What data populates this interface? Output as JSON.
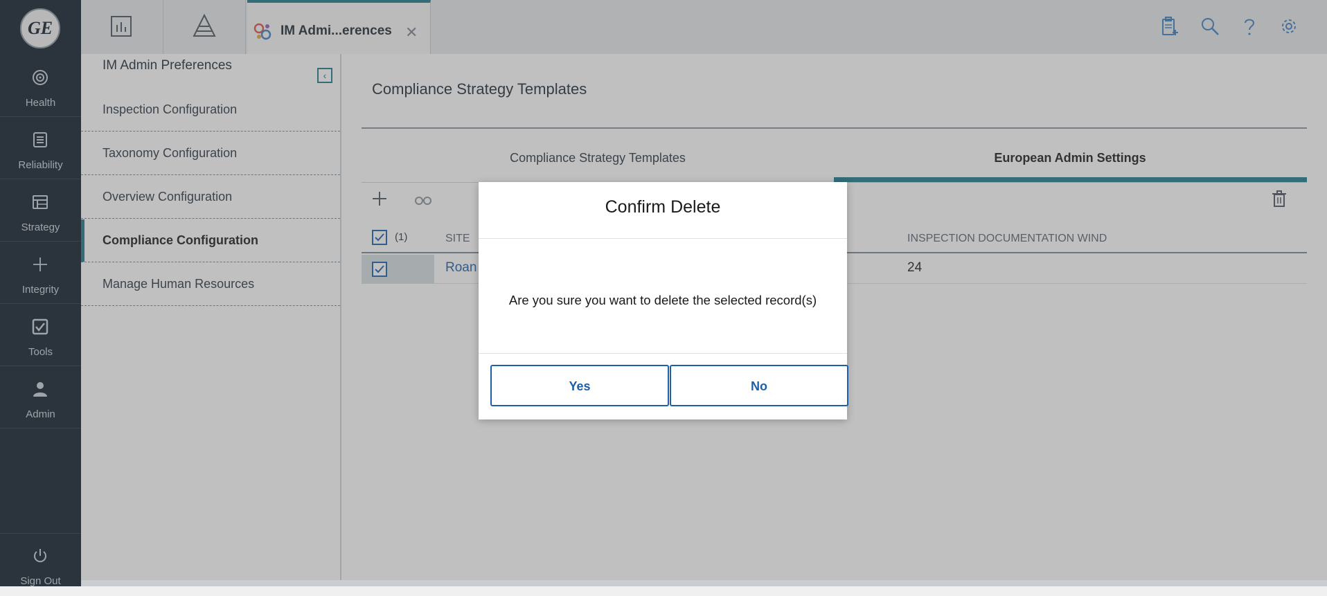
{
  "nav": {
    "logo_text": "GE",
    "items": [
      {
        "label": "Health",
        "icon": "target-icon"
      },
      {
        "label": "Reliability",
        "icon": "list-icon"
      },
      {
        "label": "Strategy",
        "icon": "table-icon"
      },
      {
        "label": "Integrity",
        "icon": "plus-icon"
      },
      {
        "label": "Tools",
        "icon": "check-square-icon"
      },
      {
        "label": "Admin",
        "icon": "user-icon"
      }
    ],
    "signout": "Sign Out"
  },
  "topbar": {
    "active_tab_title": "IM Admi...erences"
  },
  "sidepanel": {
    "title": "IM Admin Preferences",
    "items": [
      "Inspection Configuration",
      "Taxonomy Configuration",
      "Overview Configuration",
      "Compliance Configuration",
      "Manage Human Resources"
    ],
    "selected_index": 3
  },
  "content": {
    "title": "Compliance Strategy Templates",
    "tabs": [
      "Compliance Strategy Templates",
      "European Admin Settings"
    ],
    "active_tab_index": 1,
    "grid": {
      "selected_count": "(1)",
      "columns": [
        "SITE",
        "INSPECTION DOCUMENTATION WIND"
      ],
      "rows": [
        {
          "site": "Roan",
          "inspection_documentation_window": "24"
        }
      ]
    }
  },
  "modal": {
    "title": "Confirm Delete",
    "message": "Are you sure you want to delete the selected record(s)",
    "yes_label": "Yes",
    "no_label": "No"
  },
  "colors": {
    "nav_bg": "#0f1d2b",
    "accent_teal": "#1a7a8c",
    "link_blue": "#1a5fa8"
  }
}
